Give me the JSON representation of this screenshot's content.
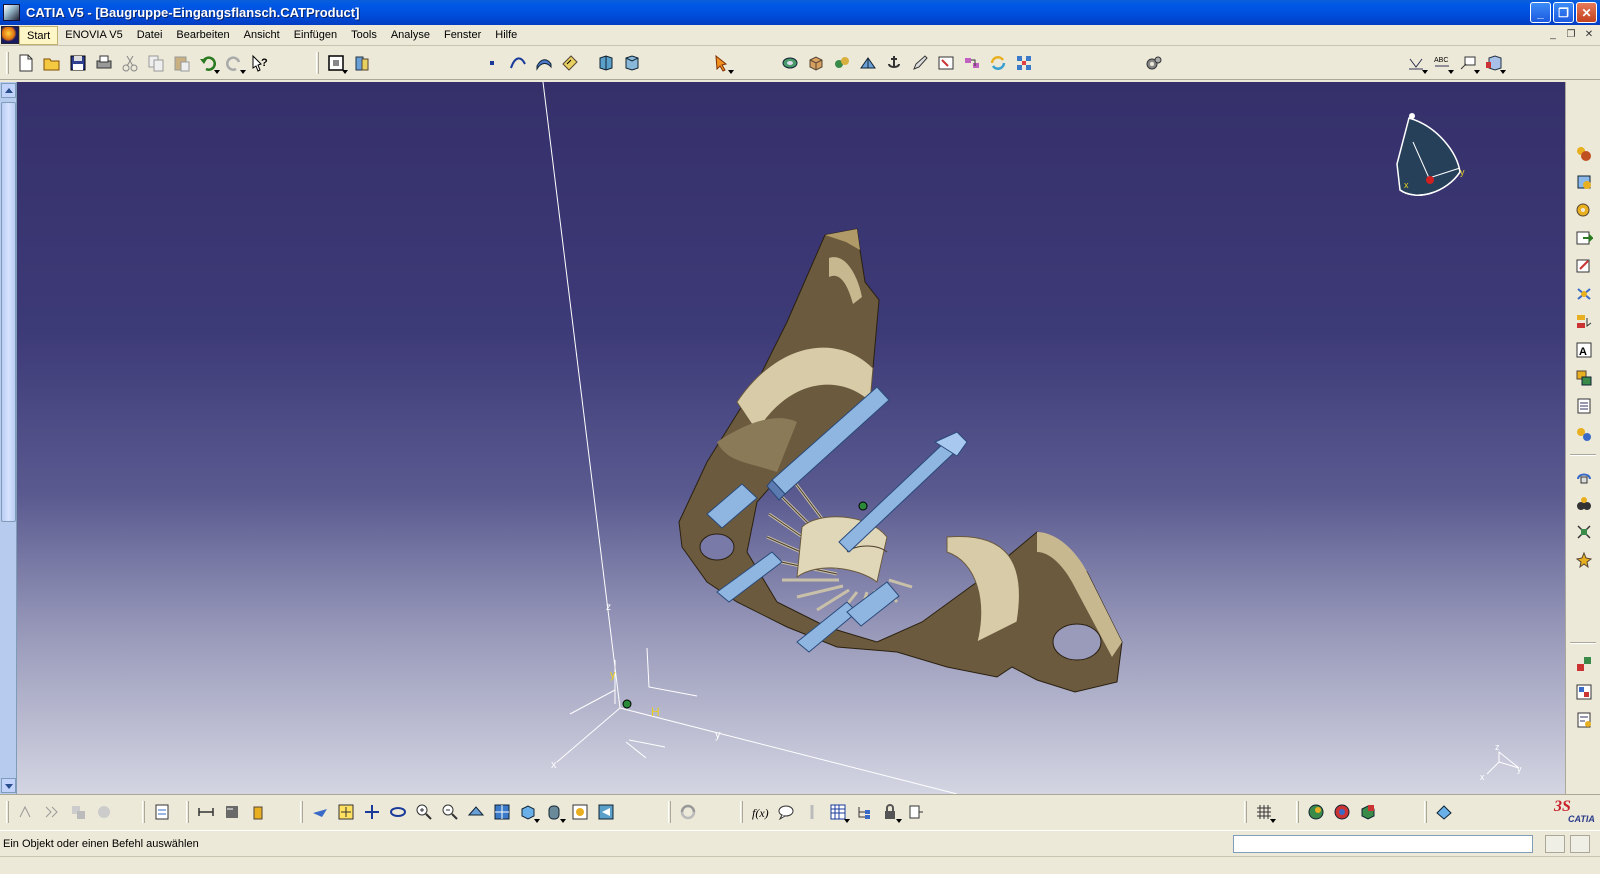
{
  "window": {
    "title": "CATIA V5 - [Baugruppe-Eingangsflansch.CATProduct]",
    "controls": {
      "minimize": "_",
      "maximize": "❐",
      "close": "✕"
    }
  },
  "menu": {
    "items": [
      {
        "label": "Start",
        "active": true
      },
      {
        "label": "ENOVIA V5"
      },
      {
        "label": "Datei"
      },
      {
        "label": "Bearbeiten"
      },
      {
        "label": "Ansicht"
      },
      {
        "label": "Einfügen"
      },
      {
        "label": "Tools"
      },
      {
        "label": "Analyse"
      },
      {
        "label": "Fenster"
      },
      {
        "label": "Hilfe"
      }
    ],
    "mdi": {
      "minimize": "_",
      "restore": "❐",
      "close": "✕"
    }
  },
  "viewport": {
    "axis_labels": {
      "z": "z",
      "y_small": "y",
      "h": "H",
      "y": "y",
      "x": "x"
    },
    "mini_axis": {
      "z": "z",
      "y": "y",
      "x": "x"
    },
    "compass": {
      "x": "x",
      "y": "y"
    }
  },
  "toolbar_top": {
    "icons": [
      "new-icon",
      "open-icon",
      "save-icon",
      "print-icon",
      "cut-icon",
      "copy-icon",
      "paste-icon",
      "undo-icon",
      "redo-icon",
      "whats-this-icon",
      "product-icon",
      "catalog-icon",
      "point-icon",
      "curve-icon",
      "surface-icon",
      "sketch-icon",
      "view-front-icon",
      "view-back-icon",
      "select-arrow-icon",
      "assembly-constraint-1-icon",
      "assembly-constraint-2-icon",
      "assembly-constraint-3-icon",
      "fix-icon",
      "anchor-icon",
      "pencil-icon",
      "snap-icon",
      "reconnect-icon",
      "update-icon",
      "explode-icon",
      "settings-gear-icon",
      "measure-icon",
      "abc-icon",
      "annotation-icon",
      "render-style-icon"
    ]
  },
  "toolbar_right": {
    "icons": [
      "new-component-icon",
      "new-product-icon",
      "new-part-icon",
      "existing-component-icon",
      "existing-positioning-icon",
      "replace-component-icon",
      "graph-tree-reorder-icon",
      "generate-numbering-icon",
      "selective-load-icon",
      "manage-representations-icon",
      "multi-instantiation-icon",
      "manipulation-icon",
      "snap-move-icon",
      "explode-move-icon",
      "stop-on-clash-icon",
      "constraint-1-icon",
      "constraint-2-icon",
      "constraint-3-icon"
    ]
  },
  "toolbar_bottom": {
    "icons": [
      "analyze-1-icon",
      "analyze-2-icon",
      "analyze-3-icon",
      "analyze-4-icon",
      "publish-icon",
      "measure-between-icon",
      "measure-item-icon",
      "measure-inertia-icon",
      "fly-mode-icon",
      "fit-all-icon",
      "pan-icon",
      "rotate-icon",
      "zoom-in-icon",
      "zoom-out-icon",
      "normal-view-icon",
      "multi-view-icon",
      "iso-view-icon",
      "shading-icon",
      "hide-show-icon",
      "swap-space-icon",
      "update-icon",
      "formula-icon",
      "comment-icon",
      "knowledge-icon",
      "table-icon",
      "tree-icon",
      "lock-icon",
      "rule-icon",
      "grid-icon",
      "render-1-icon",
      "render-2-icon",
      "render-3-icon",
      "sheet-icon"
    ],
    "logo_ds": "3S",
    "logo_catia": "CATIA"
  },
  "statusbar": {
    "message": "Ein Objekt oder einen Befehl auswählen",
    "command_value": ""
  },
  "colors": {
    "titlebar": "#0050dd",
    "viewport_top": "#35306a",
    "viewport_bottom": "#d4d5e2",
    "part_bronze": "#6b5a3e",
    "part_blue": "#8fb6e0"
  }
}
